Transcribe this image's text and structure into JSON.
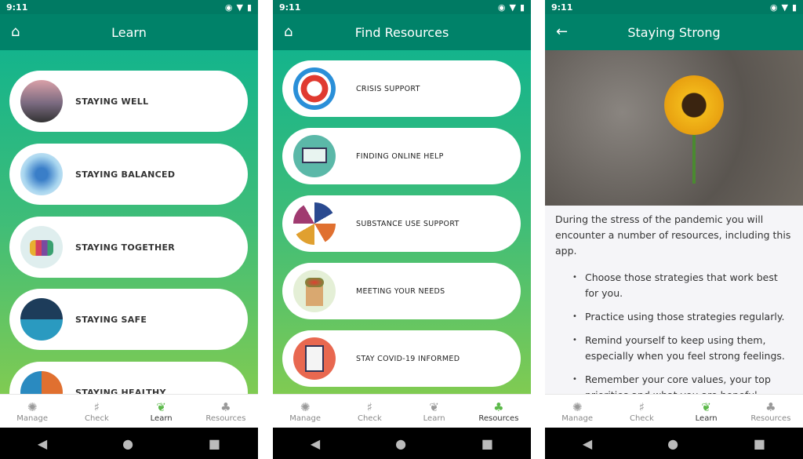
{
  "status": {
    "time": "9:11"
  },
  "screens": [
    {
      "title": "Learn",
      "lead_icon": "home-icon",
      "items": [
        "STAYING WELL",
        "STAYING BALANCED",
        "STAYING TOGETHER",
        "STAYING SAFE",
        "STAYING HEALTHY"
      ]
    },
    {
      "title": "Find Resources",
      "lead_icon": "home-icon",
      "items": [
        "CRISIS SUPPORT",
        "FINDING ONLINE HELP",
        "SUBSTANCE USE SUPPORT",
        "MEETING YOUR NEEDS",
        "STAY COVID-19 INFORMED"
      ]
    },
    {
      "title": "Staying Strong",
      "lead_icon": "back-arrow-icon",
      "intro": "During the stress of the pandemic you will encounter a number of resources, including this app.",
      "bullets": [
        "Choose those strategies that work best for you.",
        "Practice using those strategies regularly.",
        "Remind yourself to keep using them, especially when you feel strong feelings.",
        "Remember your core values, your top priorities and what you are hopeful"
      ]
    }
  ],
  "nav": [
    "Manage",
    "Check",
    "Learn",
    "Resources"
  ],
  "active_tabs": [
    "Learn",
    "Resources",
    "Learn"
  ],
  "colors": {
    "header": "#008269",
    "status": "#007a63",
    "accent": "#5cb94a"
  }
}
